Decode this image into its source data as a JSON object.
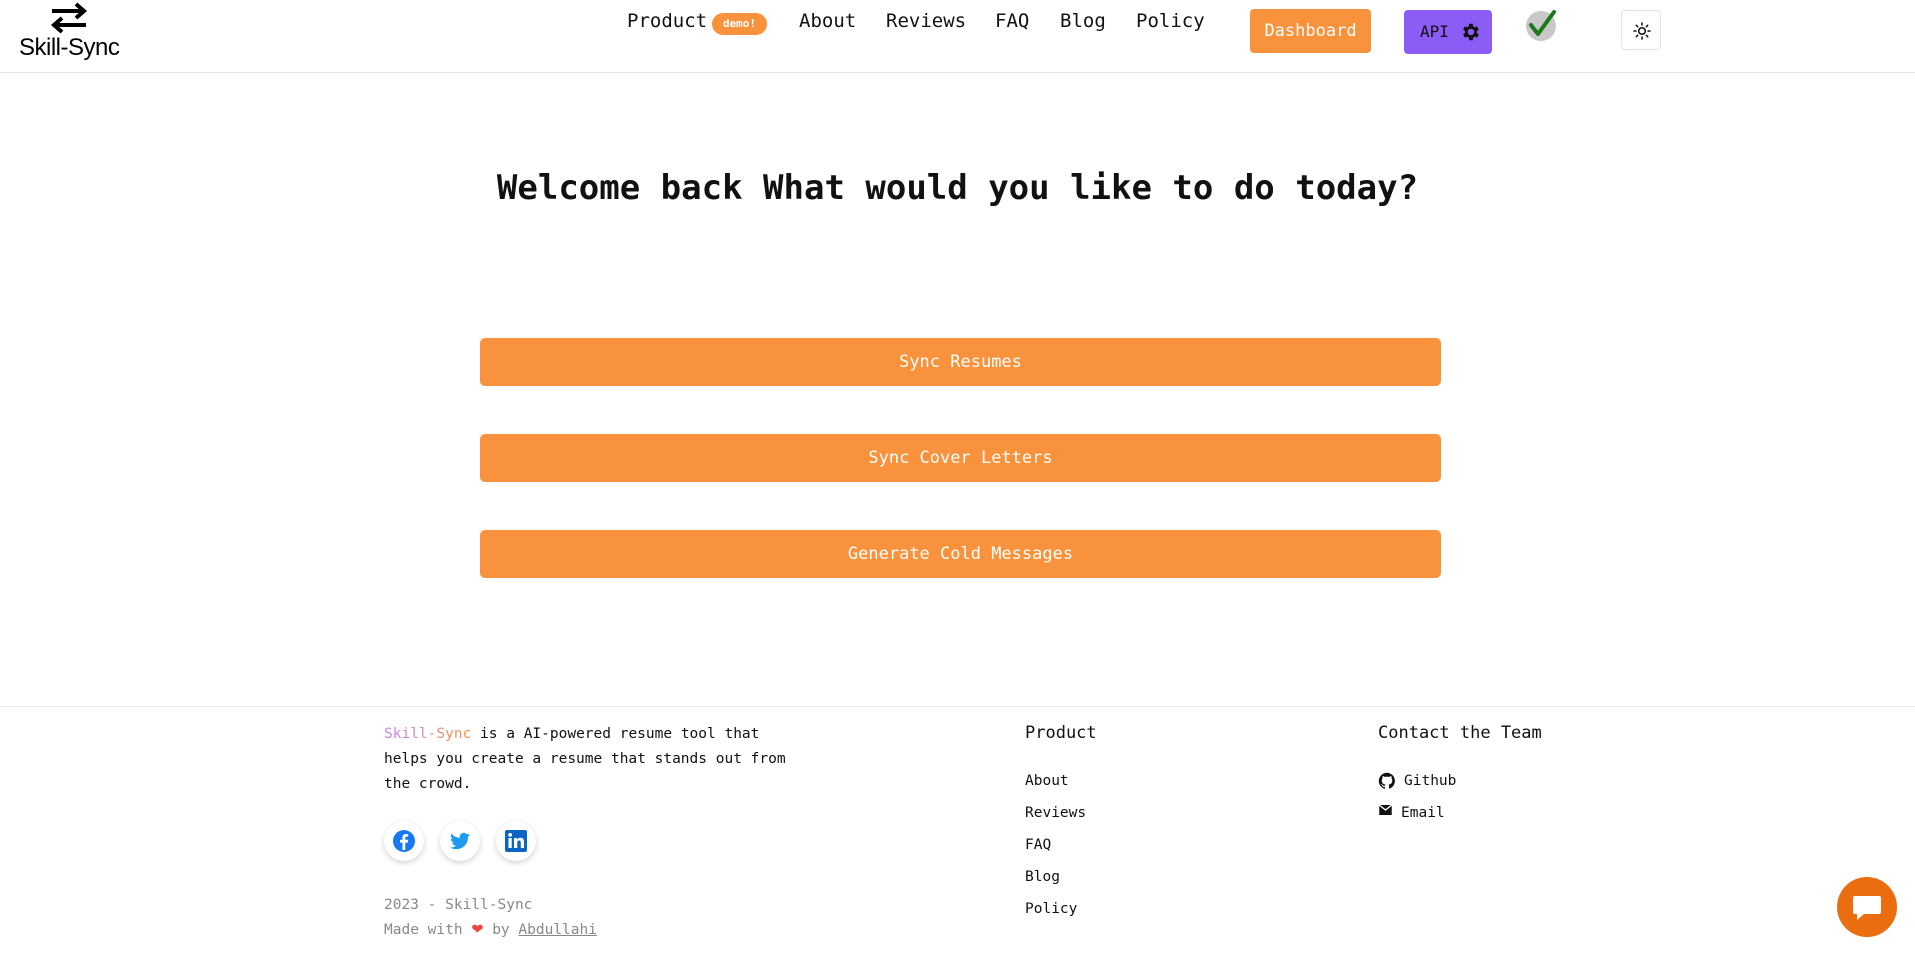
{
  "header": {
    "logo_text": "Skill-Sync",
    "nav": {
      "product": "Product",
      "product_badge": "demo!",
      "about": "About",
      "reviews": "Reviews",
      "faq": "FAQ",
      "blog": "Blog",
      "policy": "Policy"
    },
    "dashboard_label": "Dashboard",
    "api_label": "API"
  },
  "main": {
    "welcome": "Welcome back What would you like to do today?",
    "actions": [
      "Sync Resumes",
      "Sync Cover Letters",
      "Generate Cold Messages"
    ]
  },
  "footer": {
    "brand": "Skill-Sync",
    "description": " is a AI-powered resume tool that helps you create a resume that stands out from the crowd.",
    "copyright": "2023 - Skill-Sync",
    "made_with": "Made with",
    "by": "by",
    "author": "Abdullahi",
    "product_title": "Product",
    "product_links": [
      "About",
      "Reviews",
      "FAQ",
      "Blog",
      "Policy"
    ],
    "contact_title": "Contact the Team",
    "contact_links": [
      "Github",
      "Email"
    ]
  },
  "colors": {
    "accent": "#f9923c",
    "api": "#8b5cf6",
    "chat": "#ea6d10"
  }
}
